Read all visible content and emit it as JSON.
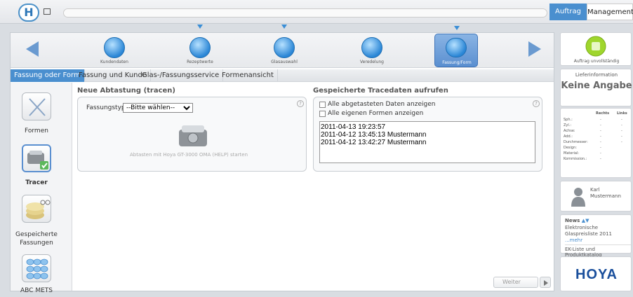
{
  "header": {
    "logo_letter": "H",
    "nav_auftrag": "Auftrag",
    "nav_management": "Management"
  },
  "steps": [
    {
      "label": "Kundendaten",
      "icon": "customer-icon"
    },
    {
      "label": "Rezeptwerte",
      "icon": "prescription-icon"
    },
    {
      "label": "Glasauswahl",
      "icon": "lens-icon"
    },
    {
      "label": "Veredelung",
      "icon": "coating-icon"
    },
    {
      "label": "Fassung/Form",
      "icon": "frame-icon",
      "active": true
    }
  ],
  "tabs": [
    "Fassung oder Form",
    "Fassung und Kunde",
    "Glas-/Fassungsservice",
    "Formenansicht"
  ],
  "left_nav": [
    {
      "label": "Formen"
    },
    {
      "label": "Tracer",
      "active": true
    },
    {
      "label": "Gespeicherte Fassungen"
    },
    {
      "label": "ABC METS"
    }
  ],
  "left_panel": {
    "title": "Neue Abtastung (tracen)",
    "fassungstyp_label": "Fassungstyp",
    "fassungstyp_value": "--Bitte wählen--",
    "hint": "Abtasten mit Hoya GT-3000 OMA (HELP) starten"
  },
  "right_panel": {
    "title": "Gespeicherte Tracedaten aufrufen",
    "check1": "Alle abgetasteten Daten anzeigen",
    "check2": "Alle eigenen Formen anzeigen",
    "entries": [
      "2011-04-13 19:23:57",
      "2011-04-12 13:45:13 Mustermann",
      "2011-04-12 13:42:27 Mustermann"
    ]
  },
  "weiter": "Weiter",
  "sidebar": {
    "status": "Auftrag unvollständig",
    "lieferinfo": "Lieferinformation",
    "keine_angabe": "Keine Angabe",
    "table_head": [
      "Rechts",
      "Links"
    ],
    "rows": [
      {
        "label": "Sph.:",
        "r": "-",
        "l": "-"
      },
      {
        "label": "Zyl.:",
        "r": "-",
        "l": "-"
      },
      {
        "label": "Achse:",
        "r": "-",
        "l": "-"
      },
      {
        "label": "Add.:",
        "r": "-",
        "l": "-"
      },
      {
        "label": "Durchmesser:",
        "r": "-",
        "l": "-"
      },
      {
        "label": "Design:",
        "r": "-",
        "l": ""
      },
      {
        "label": "Material:",
        "r": "-",
        "l": ""
      },
      {
        "label": "Kommission.:",
        "r": "-",
        "l": ""
      }
    ],
    "user_first": "Karl",
    "user_last": "Mustermann",
    "news_title": "News",
    "news_text": "Elektronische Glaspreisliste 2011",
    "news_more": "...mehr",
    "news_link": "EK-Liste und Produktkatalog",
    "brand": "HOYA"
  },
  "colors": {
    "accent": "#4a8fcf",
    "active_step": "#5a8fd0",
    "status_green": "#9fd62c",
    "brand_blue": "#1a4f9c"
  }
}
